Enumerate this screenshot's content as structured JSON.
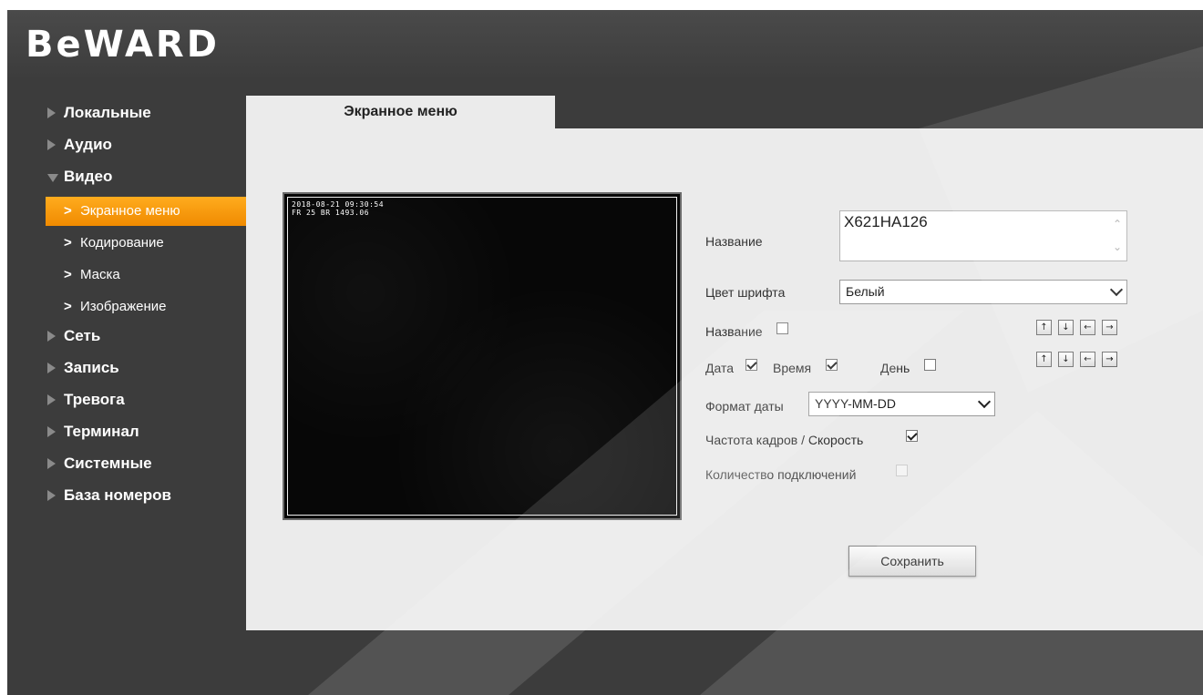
{
  "app": {
    "logo": "BeWARD"
  },
  "sidebar": {
    "items": [
      {
        "label": "Локальные",
        "open": false
      },
      {
        "label": "Аудио",
        "open": false
      },
      {
        "label": "Видео",
        "open": true
      },
      {
        "label": "Сеть",
        "open": false
      },
      {
        "label": "Запись",
        "open": false
      },
      {
        "label": "Тревога",
        "open": false
      },
      {
        "label": "Терминал",
        "open": false
      },
      {
        "label": "Системные",
        "open": false
      },
      {
        "label": "База номеров",
        "open": false
      }
    ],
    "video_sub": [
      {
        "label": "Экранное меню",
        "active": true
      },
      {
        "label": "Кодирование",
        "active": false
      },
      {
        "label": "Маска",
        "active": false
      },
      {
        "label": "Изображение",
        "active": false
      }
    ]
  },
  "tab": {
    "label": "Экранное меню"
  },
  "preview": {
    "osd_line1": "2018-08-21 09:30:54",
    "osd_line2": "FR 25 BR 1493.06"
  },
  "form": {
    "name_label": "Название",
    "name_value": "X621HA126",
    "font_color_label": "Цвет шрифта",
    "font_color_value": "Белый",
    "show_name_label": "Название",
    "show_name_checked": false,
    "date_label": "Дата",
    "date_checked": true,
    "time_label": "Время",
    "time_checked": true,
    "day_label": "День",
    "day_checked": false,
    "date_format_label": "Формат даты",
    "date_format_value": "YYYY-MM-DD",
    "framerate_label": "Частота кадров / Скорость",
    "framerate_checked": true,
    "connections_label": "Количество подключений",
    "connections_checked": false,
    "connections_disabled": true,
    "arrow_up": "↑",
    "arrow_down": "↓",
    "arrow_left": "←",
    "arrow_right": "→",
    "save_label": "Сохранить"
  },
  "colors": {
    "background": "#3c3c3c",
    "panel": "#ebebeb",
    "accent": "#f59a0a"
  }
}
